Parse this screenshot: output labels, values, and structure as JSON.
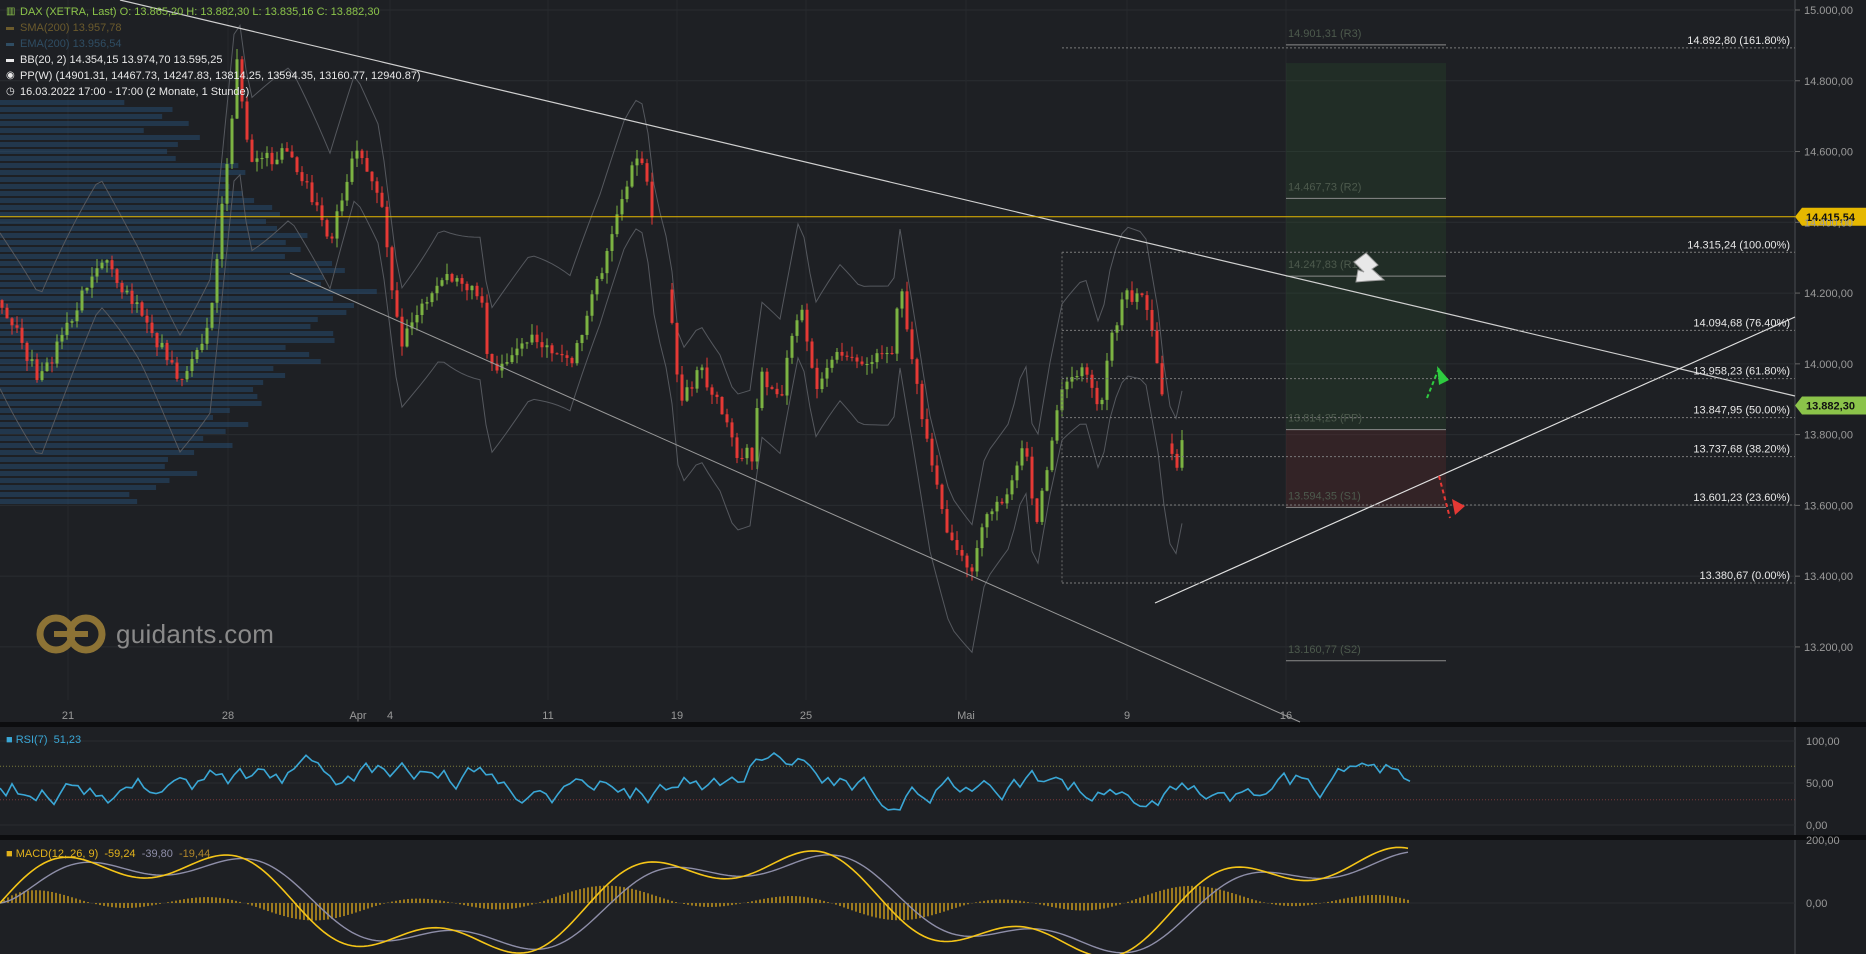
{
  "legend": {
    "dax": "DAX (XETRA, Last)   O: 13.865,20   H: 13.882,30   L: 13.835,16   C: 13.882,30",
    "sma": "SMA(200)   13.957,78",
    "ema": "EMA(200)   13.956,54",
    "bb": "BB(20, 2)   14.354,15   13.974,70   13.595,25",
    "pp": "PP(W)   (14901.31, 14467.73, 14247.83, 13814.25, 13594.35, 13160.77, 12940.87)",
    "time": "16.03.2022 17:00 - 17:00   (2 Monate, 1 Stunde)"
  },
  "logo": {
    "text": "guidants.com"
  },
  "colors": {
    "background": "#1e2024",
    "up": "#7cb342",
    "down": "#e53935",
    "rsi": "#3aa7d6",
    "macd": "#f5c518",
    "signal": "#8e8ea8",
    "hline": "#e6b800",
    "last_price": "#8bc34a"
  },
  "chart_data": [
    {
      "type": "candlestick",
      "title": "DAX (XETRA, Last)",
      "ylim": [
        13050,
        15000
      ],
      "yticks": [
        "15.000,00",
        "14.800,00",
        "14.600,00",
        "14.400,00",
        "14.200,00",
        "14.000,00",
        "13.800,00",
        "13.600,00",
        "13.400,00",
        "13.200,00"
      ],
      "xticks": [
        "21",
        "28",
        "Apr",
        "4",
        "11",
        "19",
        "25",
        "Mai",
        "9",
        "16"
      ],
      "anchors": [
        [
          0,
          14180
        ],
        [
          40,
          13950
        ],
        [
          100,
          14300
        ],
        [
          140,
          14150
        ],
        [
          180,
          13950
        ],
        [
          210,
          14100
        ],
        [
          237,
          14850
        ],
        [
          250,
          14560
        ],
        [
          290,
          14600
        ],
        [
          330,
          14350
        ],
        [
          355,
          14600
        ],
        [
          380,
          14480
        ],
        [
          400,
          14050
        ],
        [
          440,
          14250
        ],
        [
          480,
          14200
        ],
        [
          490,
          13980
        ],
        [
          530,
          14080
        ],
        [
          570,
          14000
        ],
        [
          600,
          14250
        ],
        [
          625,
          14500
        ],
        [
          640,
          14590
        ],
        [
          648,
          14490
        ],
        [
          655,
          14330
        ],
        [
          670,
          14180
        ],
        [
          680,
          13900
        ],
        [
          700,
          13980
        ],
        [
          720,
          13880
        ],
        [
          735,
          13750
        ],
        [
          752,
          13740
        ],
        [
          760,
          13980
        ],
        [
          780,
          13900
        ],
        [
          800,
          14180
        ],
        [
          815,
          13920
        ],
        [
          840,
          14040
        ],
        [
          860,
          14000
        ],
        [
          893,
          14050
        ],
        [
          900,
          14220
        ],
        [
          915,
          13980
        ],
        [
          930,
          13720
        ],
        [
          950,
          13500
        ],
        [
          972,
          13400
        ],
        [
          985,
          13580
        ],
        [
          1010,
          13640
        ],
        [
          1025,
          13800
        ],
        [
          1035,
          13520
        ],
        [
          1050,
          13760
        ],
        [
          1062,
          13920
        ],
        [
          1085,
          14000
        ],
        [
          1100,
          13870
        ],
        [
          1112,
          14080
        ],
        [
          1125,
          14190
        ],
        [
          1145,
          14200
        ],
        [
          1158,
          14000
        ],
        [
          1168,
          13750
        ],
        [
          1178,
          13700
        ],
        [
          1186,
          13882
        ]
      ],
      "horizontal_lines": [
        {
          "value": 14415.54,
          "label": "14.415,54",
          "kind": "marker"
        },
        {
          "value": 13882.3,
          "label": "13.882,30",
          "kind": "last"
        }
      ],
      "fibonacci": [
        {
          "value": 14892.8,
          "label": "14.892,80 (161.80%)"
        },
        {
          "value": 14315.24,
          "label": "14.315,24 (100.00%)"
        },
        {
          "value": 14094.68,
          "label": "14.094,68 (76.40%)"
        },
        {
          "value": 13958.23,
          "label": "13.958,23 (61.80%)"
        },
        {
          "value": 13847.95,
          "label": "13.847,95 (50.00%)"
        },
        {
          "value": 13737.68,
          "label": "13.737,68 (38.20%)"
        },
        {
          "value": 13601.23,
          "label": "13.601,23 (23.60%)"
        },
        {
          "value": 13380.67,
          "label": "13.380,67 (0.00%)"
        }
      ],
      "pivots": [
        {
          "value": 14901.31,
          "label": "14.901,31 (R3)"
        },
        {
          "value": 14467.73,
          "label": "14.467,73 (R2)"
        },
        {
          "value": 14247.83,
          "label": "14.247,83 (R1)"
        },
        {
          "value": 13814.25,
          "label": "13.814,25 (PP)"
        },
        {
          "value": 13594.35,
          "label": "13.594,35 (S1)"
        },
        {
          "value": 13160.77,
          "label": "13.160,77 (S2)"
        }
      ]
    },
    {
      "type": "line",
      "title": "RSI(7)",
      "last_value": "51,23",
      "ylim": [
        0,
        100
      ],
      "yticks": [
        "100,00",
        "50,00",
        "0,00"
      ],
      "levels": [
        70,
        30
      ]
    },
    {
      "type": "line",
      "title": "MACD(12, 26, 9)",
      "values": [
        "-59,24",
        "-39,80",
        "-19,44"
      ],
      "yticks": [
        "200,00",
        "0,00"
      ]
    }
  ]
}
